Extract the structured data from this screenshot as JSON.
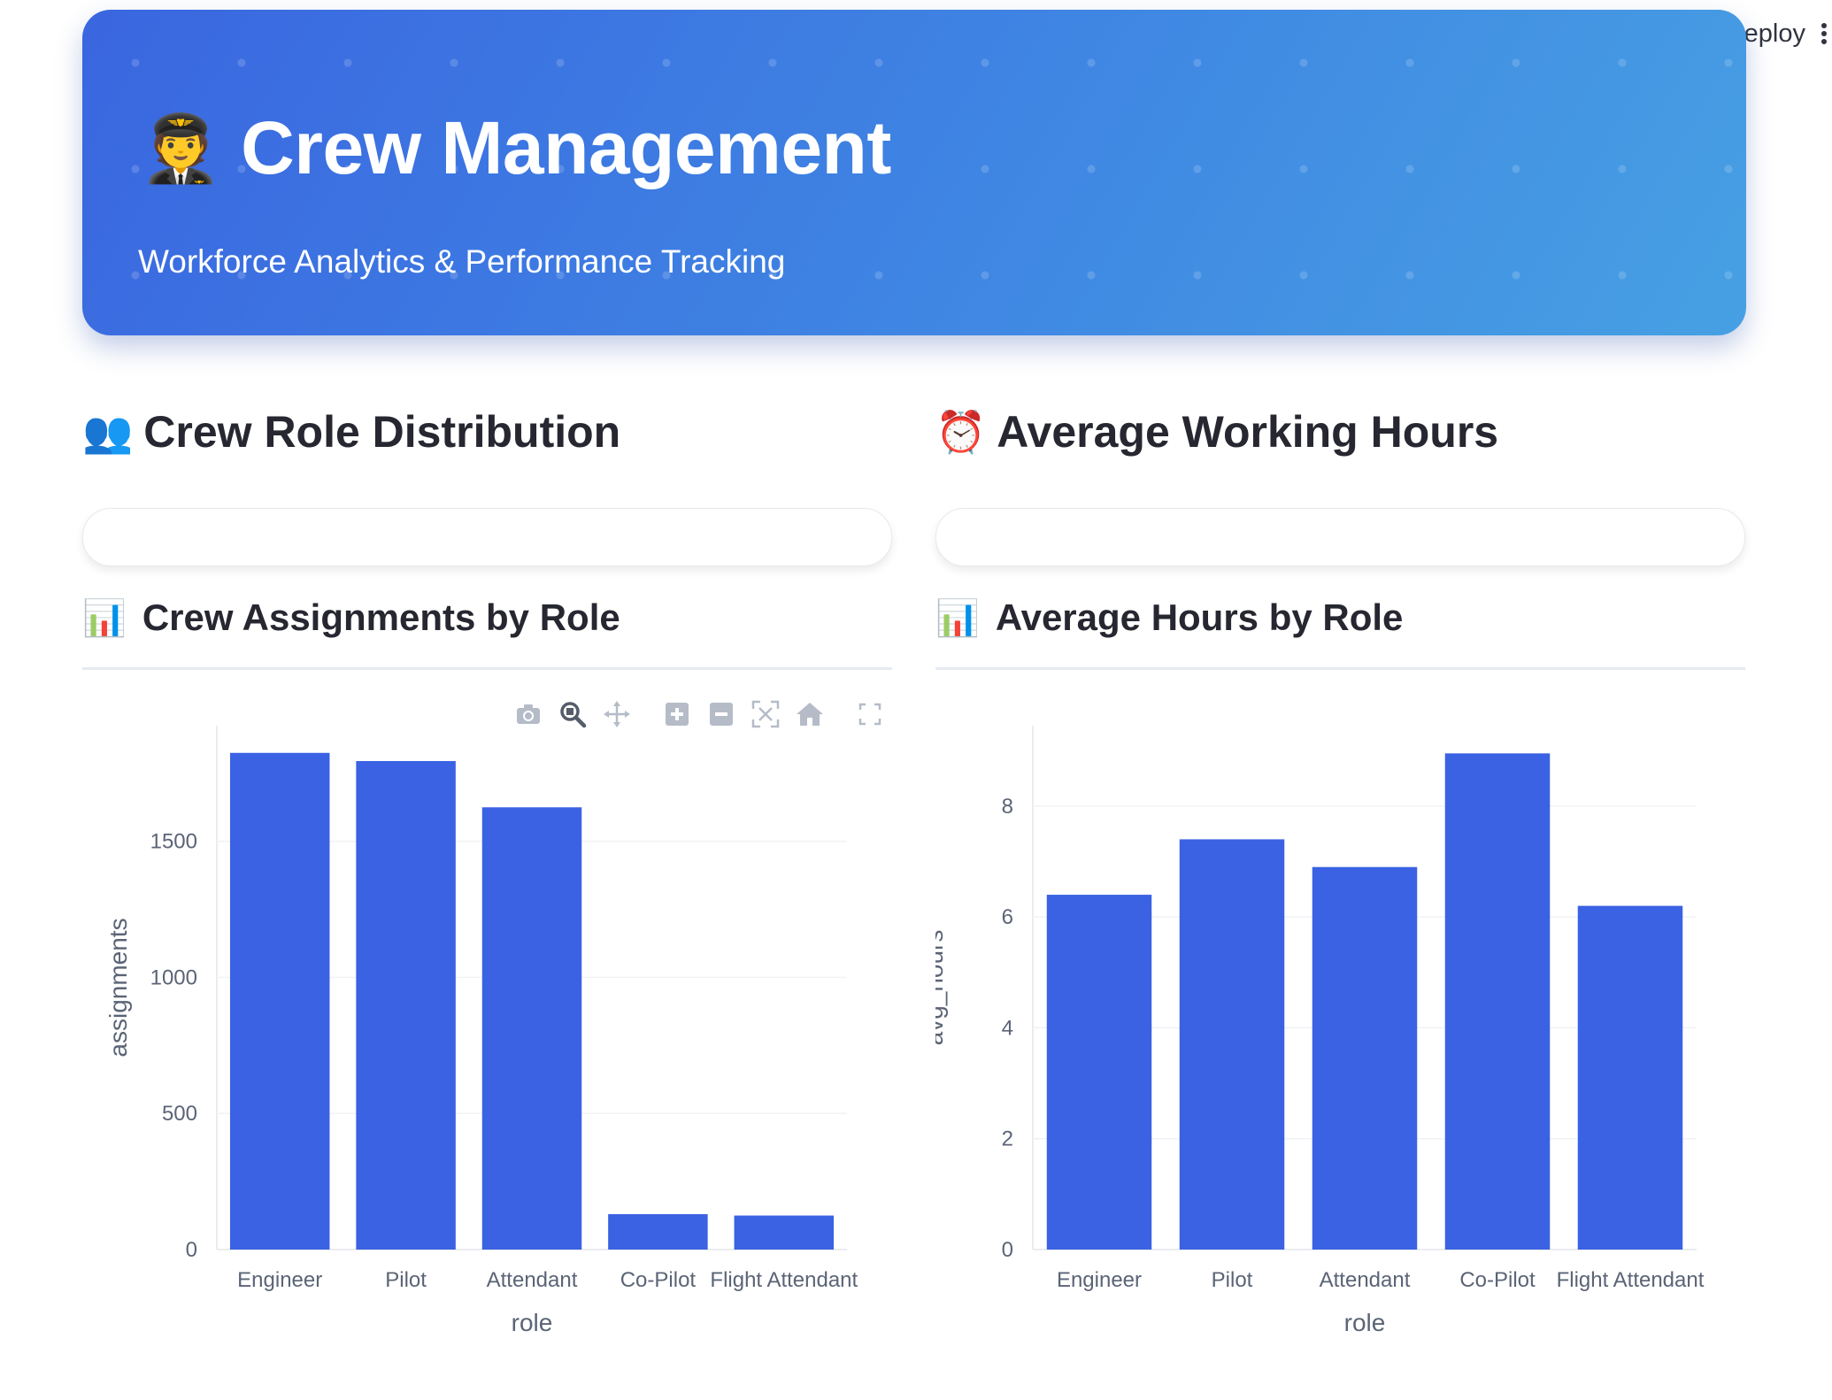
{
  "toolbar": {
    "deploy_label": "Deploy"
  },
  "hero": {
    "emoji": "🧑‍✈️",
    "title": "Crew Management",
    "subtitle": "Workforce Analytics & Performance Tracking"
  },
  "left": {
    "section_emoji": "👥",
    "section_title": "Crew Role Distribution",
    "chart_emoji": "📊",
    "chart_title": "Crew Assignments by Role"
  },
  "right": {
    "section_emoji": "⏰",
    "section_title": "Average Working Hours",
    "chart_emoji": "📊",
    "chart_title": "Average Hours by Role"
  },
  "modebar": [
    "camera-icon",
    "zoom-icon",
    "pan-icon",
    "zoom-in-icon",
    "zoom-out-icon",
    "autoscale-icon",
    "reset-axes-icon",
    "fullscreen-icon"
  ],
  "colors": {
    "bar": "#3a62e3",
    "axis_text": "#5b6476"
  },
  "chart_data": [
    {
      "type": "bar",
      "title": "",
      "categories": [
        "Engineer",
        "Pilot",
        "Attendant",
        "Co-Pilot",
        "Flight Attendant"
      ],
      "values": [
        1825,
        1795,
        1625,
        130,
        125
      ],
      "xlabel": "role",
      "ylabel": "assignments",
      "ylim": [
        0,
        1925
      ],
      "yticks": [
        0,
        500,
        1000,
        1500
      ],
      "grid": true
    },
    {
      "type": "bar",
      "title": "",
      "categories": [
        "Engineer",
        "Pilot",
        "Attendant",
        "Co-Pilot",
        "Flight Attendant"
      ],
      "values": [
        6.4,
        7.4,
        6.9,
        8.95,
        6.2
      ],
      "xlabel": "role",
      "ylabel": "avg_hours",
      "ylim": [
        0,
        9.45
      ],
      "yticks": [
        0,
        2,
        4,
        6,
        8
      ],
      "grid": true
    }
  ]
}
